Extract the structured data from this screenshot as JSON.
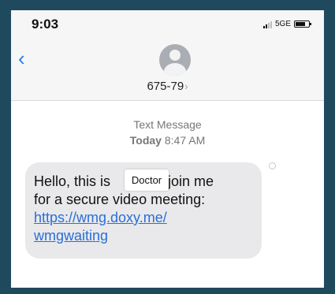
{
  "status_bar": {
    "time": "9:03",
    "network": "5G",
    "network_suffix": "E",
    "battery_icon": "battery-icon"
  },
  "header": {
    "back_icon": "chevron-left-icon",
    "contact_name": "675-79",
    "contact_chevron": "›"
  },
  "message_meta": {
    "label": "Text Message",
    "day": "Today",
    "time": "8:47 AM"
  },
  "message": {
    "line1_prefix": "Hello, this is",
    "line1_suffix": "- join me",
    "line2": "for a secure video meeting:",
    "link_line1": "https://wmg.doxy.me/",
    "link_line2": "wmgwaiting",
    "redaction_label": "Doctor"
  },
  "colors": {
    "background": "#1f4a5e",
    "accent": "#2b7cf6",
    "bubble": "#e9e9eb",
    "link": "#2a6fd6"
  }
}
